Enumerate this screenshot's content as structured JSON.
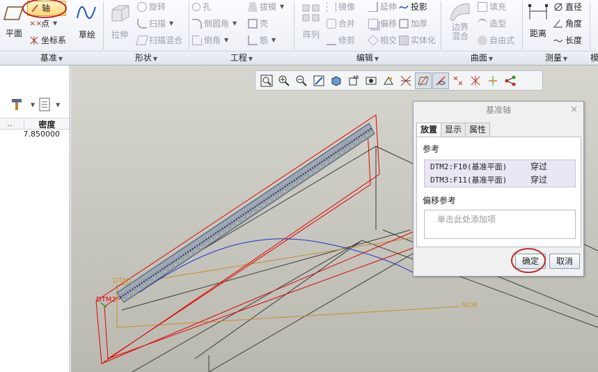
{
  "ribbon": {
    "groups": {
      "datum": {
        "label": "基准",
        "plane": "平面",
        "axis": "轴",
        "point": "点",
        "csys": "坐标系",
        "sketch": "草绘"
      },
      "shapes": {
        "label": "形状",
        "extrude": "拉伸",
        "revolve": "旋转",
        "sweep": "扫描",
        "swept_blend": "扫描混合"
      },
      "engineering": {
        "label": "工程",
        "hole": "孔",
        "round": "倒圆角",
        "chamfer": "倒角",
        "draft": "拔模",
        "shell": "壳",
        "rib": "筋"
      },
      "editing": {
        "label": "编辑",
        "pattern": "阵列",
        "mirror": "镜像",
        "merge": "合并",
        "trim": "修剪",
        "extend": "延伸",
        "offset": "偏移",
        "intersect": "相交",
        "project": "投影",
        "thicken": "加厚",
        "solidify": "实体化"
      },
      "surfaces": {
        "label": "曲面",
        "boundary_blend": "边界\n混合",
        "fill": "填充",
        "style": "造型",
        "freestyle": "自由式"
      },
      "measure": {
        "label": "测量",
        "distance": "距离",
        "diameter": "直径",
        "angle": "角度",
        "length": "长度"
      },
      "extra": {
        "label": "模"
      }
    },
    "dropdown_arrow": "▼"
  },
  "left_panel": {
    "column_dots": "..",
    "column_header": "密度",
    "value": "7.850000"
  },
  "viewport": {
    "labels": {
      "dtm1": "DTM1",
      "dtm2": "DTM2",
      "side": "SIDE"
    }
  },
  "dialog": {
    "title": "基准轴",
    "close": "×",
    "tabs": [
      "放置",
      "显示",
      "属性"
    ],
    "references_label": "参考",
    "references": [
      {
        "ref": "DTM2:F10(基准平面)",
        "constraint": "穿过"
      },
      {
        "ref": "DTM3:F11(基准平面)",
        "constraint": "穿过"
      }
    ],
    "offset_label": "偏移参考",
    "offset_placeholder": "单击此处添加项",
    "ok": "确定",
    "cancel": "取消"
  },
  "colors": {
    "annotation_red": "#c0282a",
    "axis_blue": "#2030d0",
    "datum_red": "#e00000"
  }
}
